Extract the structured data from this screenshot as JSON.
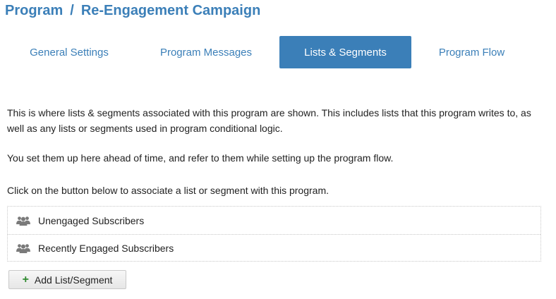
{
  "breadcrumb": {
    "root": "Program",
    "separator": "/",
    "current": "Re-Engagement Campaign"
  },
  "tabs": [
    {
      "label": "General Settings",
      "active": false
    },
    {
      "label": "Program Messages",
      "active": false
    },
    {
      "label": "Lists & Segments",
      "active": true
    },
    {
      "label": "Program Flow",
      "active": false
    }
  ],
  "description": {
    "p1": "This is where lists & segments associated with this program are shown. This includes lists that this program writes to, as well as any lists or segments used in program conditional logic.",
    "p2": "You set them up here ahead of time, and refer to them while setting up the program flow.",
    "p3": "Click on the button below to associate a list or segment with this program."
  },
  "lists": [
    {
      "icon": "users-icon",
      "label": "Unengaged Subscribers"
    },
    {
      "icon": "users-icon",
      "label": "Recently Engaged Subscribers"
    }
  ],
  "add_button": {
    "icon": "plus-icon",
    "label": "Add List/Segment"
  },
  "colors": {
    "accent": "#3b7fb8",
    "icon_gray": "#7a7a7a",
    "plus_green": "#2f8a2f"
  }
}
